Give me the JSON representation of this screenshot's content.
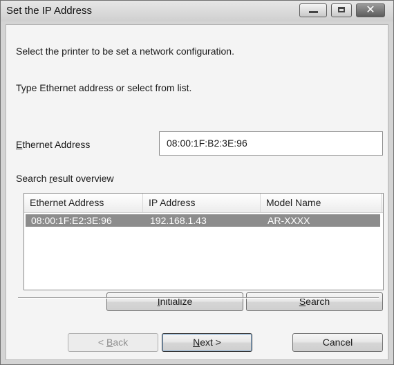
{
  "window": {
    "title": "Set the IP Address",
    "close_glyph": "✕"
  },
  "content": {
    "instruction_1": "Select the printer to be set a network configuration.",
    "instruction_2": "Type Ethernet address or select from list.",
    "ethernet_label_mnemonic": "E",
    "ethernet_label_rest": "thernet Address",
    "ethernet_value": "08:00:1F:B2:3E:96",
    "search_label_pre": "Search ",
    "search_label_mnemonic": "r",
    "search_label_post": "esult overview"
  },
  "results": {
    "columns": [
      "Ethernet Address",
      "IP Address",
      "Model Name"
    ],
    "rows": [
      {
        "ethernet": "08:00:1F:E2:3E:96",
        "ip": "192.168.1.43",
        "model": "AR-XXXX",
        "selected": true
      }
    ]
  },
  "buttons": {
    "initialize_mnemonic": "I",
    "initialize_rest": "nitialize",
    "search_mnemonic": "S",
    "search_rest": "earch",
    "back_pre": "< ",
    "back_mnemonic": "B",
    "back_rest": "ack",
    "next_mnemonic": "N",
    "next_rest": "ext >",
    "cancel": "Cancel"
  },
  "icons": [
    "minimize-icon",
    "maximize-icon",
    "close-icon"
  ]
}
